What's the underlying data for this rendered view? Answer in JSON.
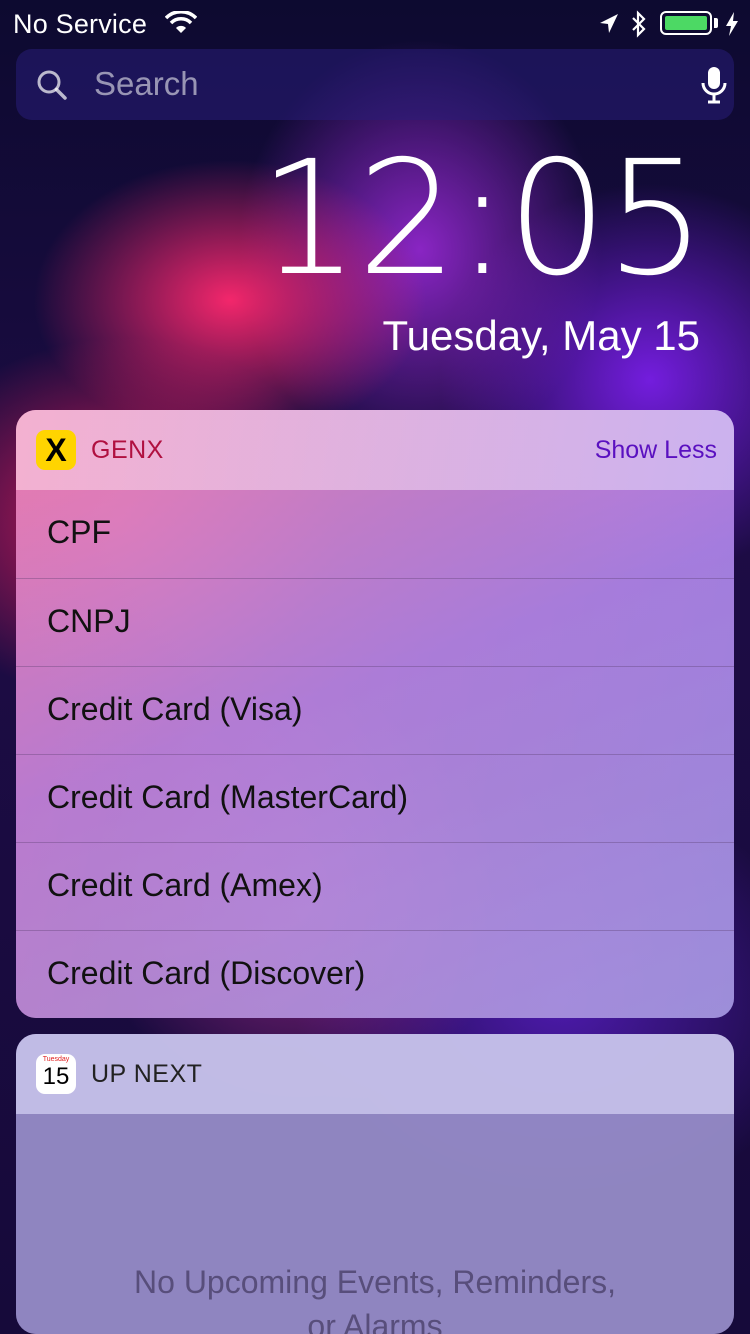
{
  "status_bar": {
    "carrier": "No Service",
    "battery_level": 1.0,
    "battery_color": "#4cd964",
    "icons": [
      "wifi-icon",
      "location-arrow-icon",
      "bluetooth-icon",
      "battery-icon",
      "charging-bolt-icon"
    ]
  },
  "search": {
    "placeholder": "Search"
  },
  "lock_screen": {
    "time": "12:05",
    "date": "Tuesday, May 15"
  },
  "genx_widget": {
    "app_name": "GENX",
    "icon_letter": "X",
    "toggle_label": "Show Less",
    "items": [
      "CPF",
      "CNPJ",
      "Credit Card (Visa)",
      "Credit Card (MasterCard)",
      "Credit Card (Amex)",
      "Credit Card (Discover)"
    ]
  },
  "up_next_widget": {
    "app_name": "UP NEXT",
    "calendar_weekday": "Tuesday",
    "calendar_day": "15",
    "empty_line1": "No Upcoming Events, Reminders,",
    "empty_line2": "or Alarms"
  }
}
